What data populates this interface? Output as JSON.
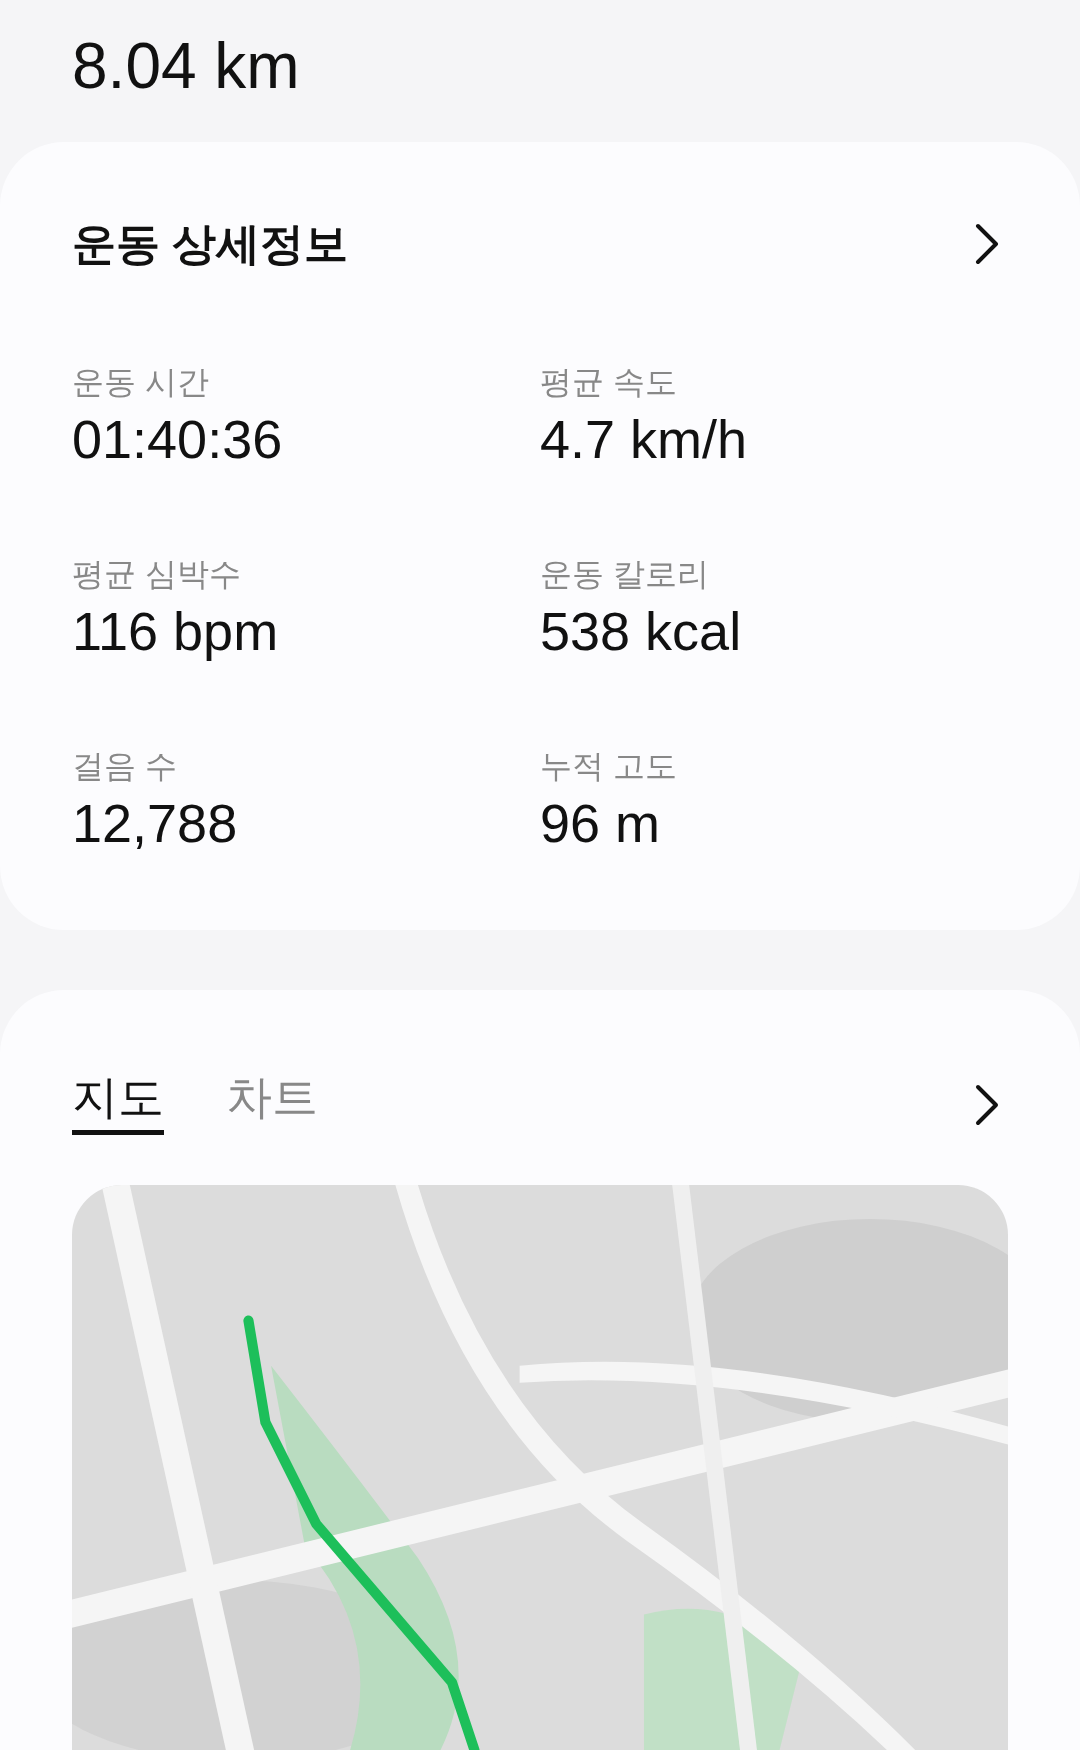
{
  "distance": "8.04 km",
  "details": {
    "title": "운동 상세정보",
    "stats": [
      {
        "label": "운동 시간",
        "value": "01:40:36"
      },
      {
        "label": "평균 속도",
        "value": "4.7 km/h"
      },
      {
        "label": "평균 심박수",
        "value": "116 bpm"
      },
      {
        "label": "운동 칼로리",
        "value": "538 kcal"
      },
      {
        "label": "걸음 수",
        "value": "12,788"
      },
      {
        "label": "누적 고도",
        "value": "96 m"
      }
    ]
  },
  "route": {
    "tabs": [
      {
        "label": "지도",
        "selected": true
      },
      {
        "label": "차트",
        "selected": false
      }
    ]
  }
}
